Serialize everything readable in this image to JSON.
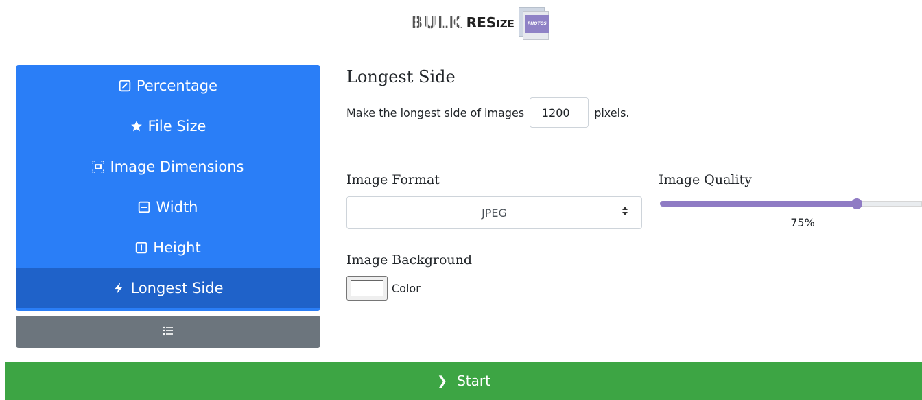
{
  "logo": {
    "bulk": "BULK",
    "resize_main": "RES",
    "resize_i": "I",
    "resize_ze": "ZE",
    "photos": "PHOTOS"
  },
  "menu": {
    "items": [
      {
        "label": "Percentage",
        "icon": "pencil-square-icon"
      },
      {
        "label": "File Size",
        "icon": "star-icon"
      },
      {
        "label": "Image Dimensions",
        "icon": "dimensions-icon"
      },
      {
        "label": "Width",
        "icon": "width-icon"
      },
      {
        "label": "Height",
        "icon": "height-icon"
      },
      {
        "label": "Longest Side",
        "icon": "lightning-icon",
        "active": true
      }
    ],
    "list_icon": "list-icon"
  },
  "section": {
    "title": "Longest Side",
    "prefix": "Make the longest side of images",
    "value": "1200",
    "suffix": "pixels."
  },
  "format": {
    "label": "Image Format",
    "selected": "JPEG"
  },
  "quality": {
    "label": "Image Quality",
    "value": 75,
    "value_text": "75%"
  },
  "background": {
    "label": "Image Background",
    "color_label": "Color",
    "color": "#ffffff"
  },
  "start": {
    "label": "Start"
  },
  "colors": {
    "menu_blue": "#2a7ef7",
    "menu_active": "#1f62c9",
    "list_gray": "#6c757d",
    "start_green": "#3da544",
    "slider": "#8f7bc4"
  }
}
